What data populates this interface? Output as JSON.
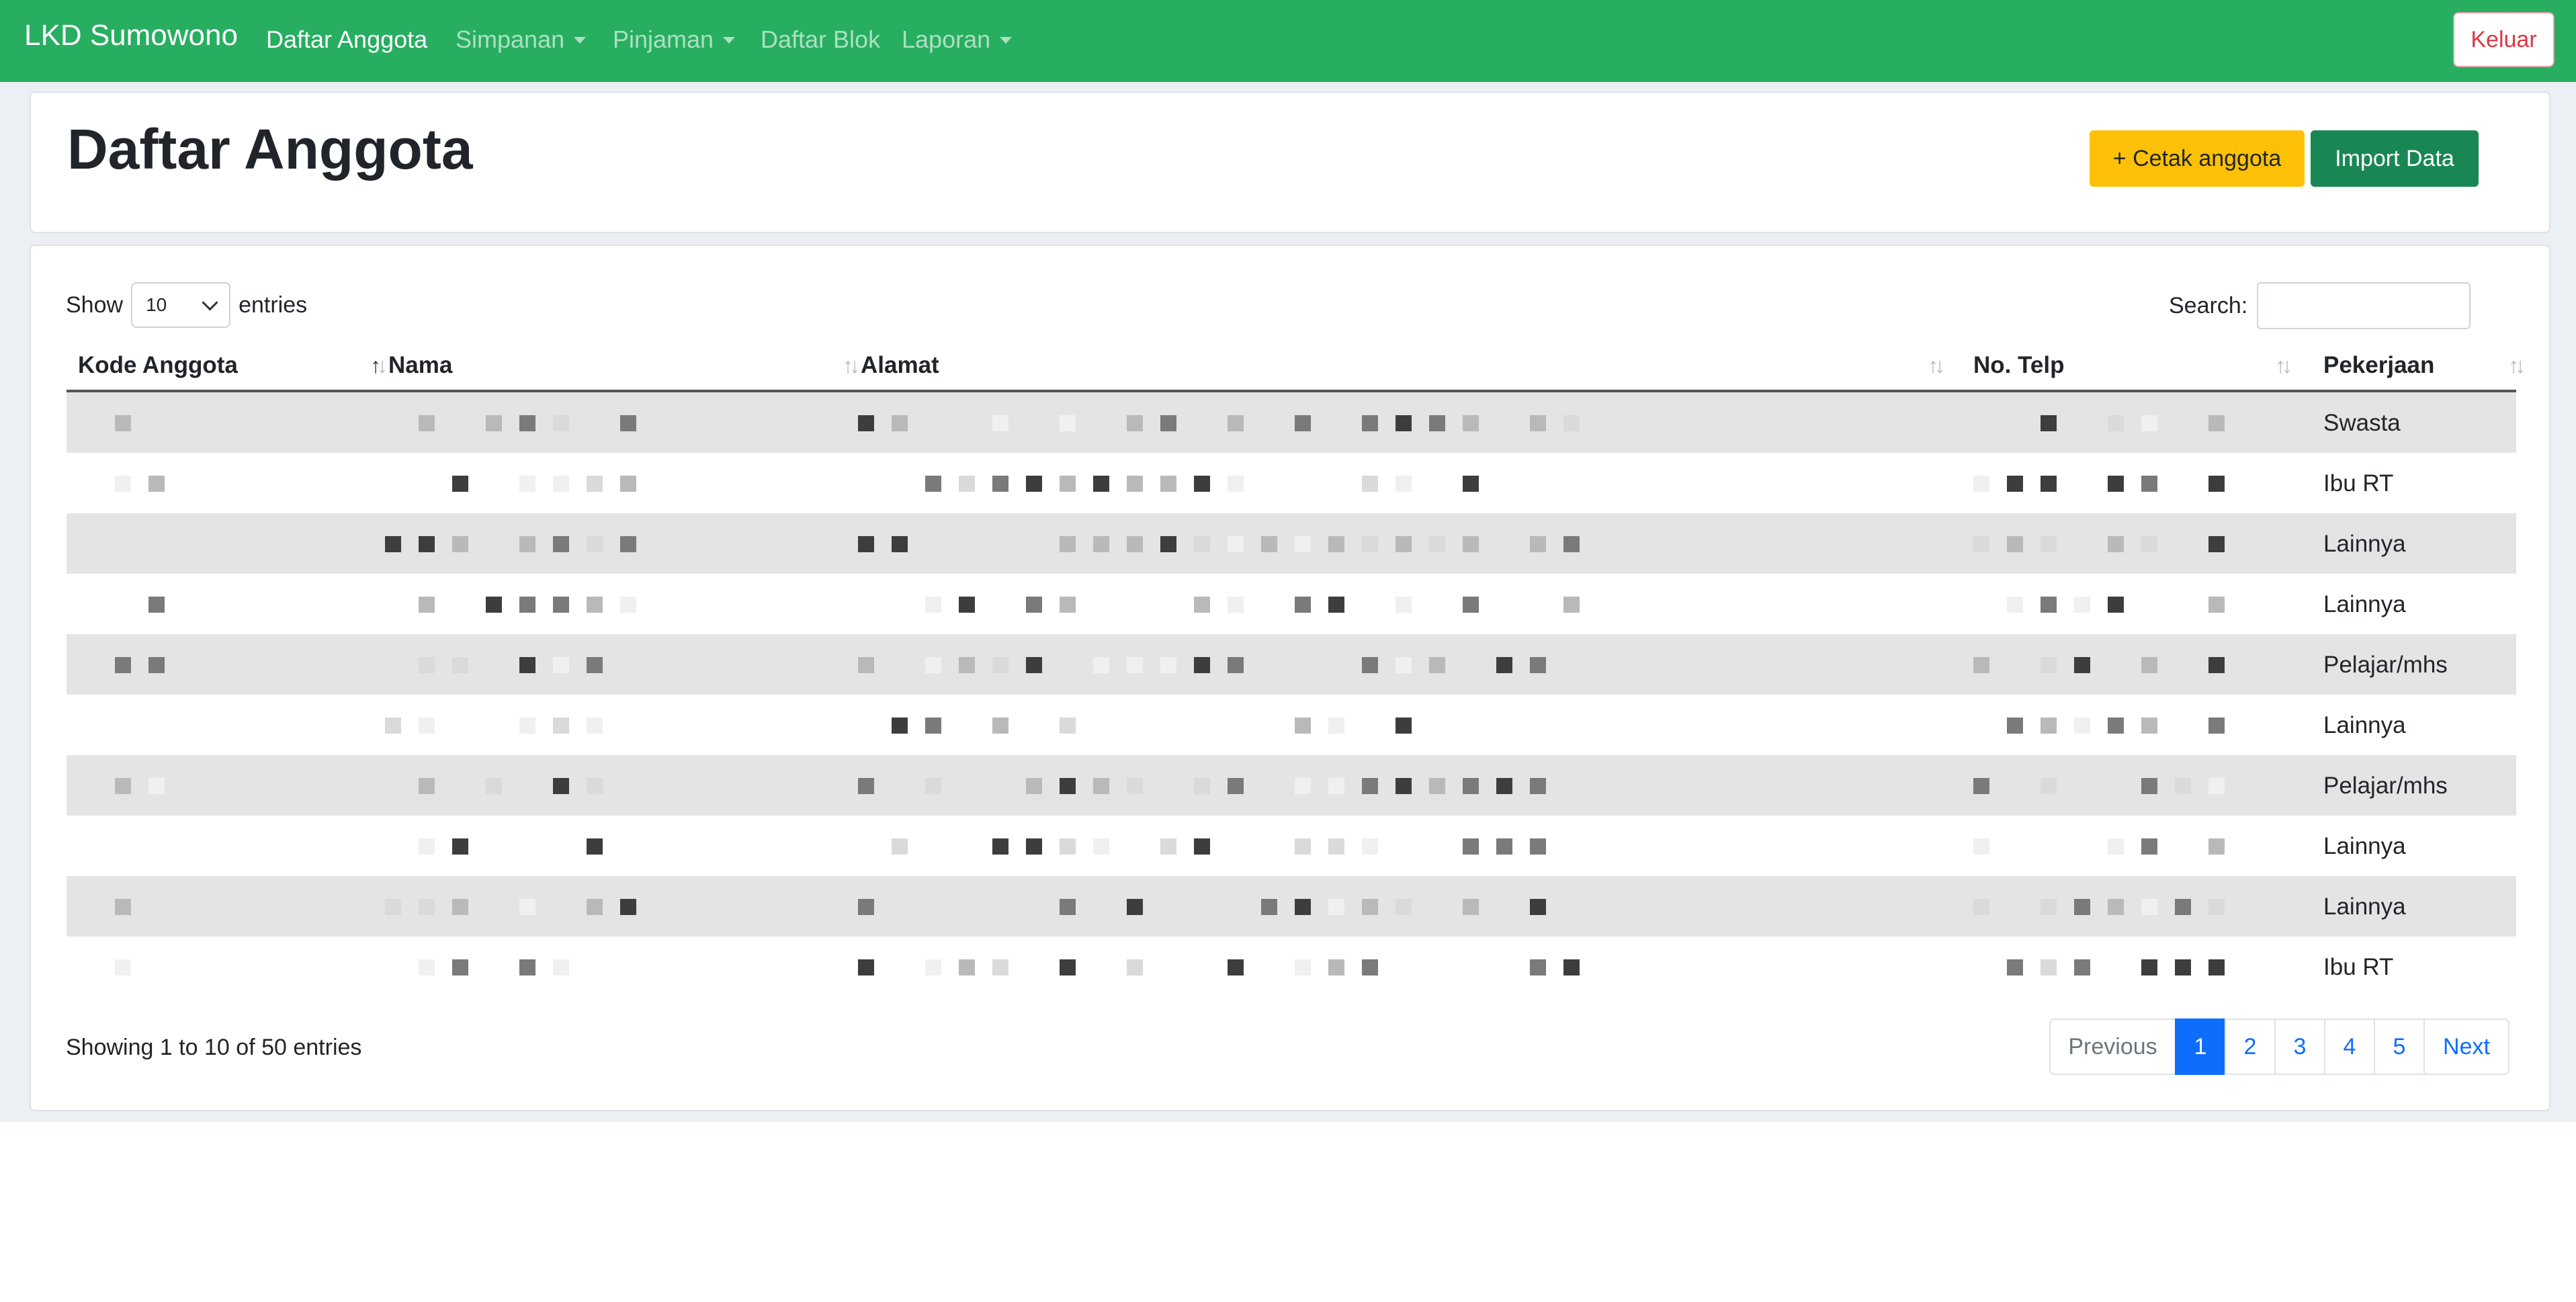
{
  "navbar": {
    "brand": "LKD Sumowono",
    "items": [
      {
        "label": "Daftar Anggota",
        "active": true,
        "dropdown": false
      },
      {
        "label": "Simpanan",
        "active": false,
        "dropdown": true
      },
      {
        "label": "Pinjaman",
        "active": false,
        "dropdown": true
      },
      {
        "label": "Daftar Blok",
        "active": false,
        "dropdown": false
      },
      {
        "label": "Laporan",
        "active": false,
        "dropdown": true
      }
    ],
    "logout_label": "Keluar"
  },
  "header": {
    "title": "Daftar Anggota",
    "print_button": "+ Cetak anggota",
    "import_button": "Import Data"
  },
  "table_controls": {
    "show_label": "Show",
    "entries_value": "10",
    "entries_label": "entries",
    "search_label": "Search:",
    "search_value": ""
  },
  "table": {
    "columns": [
      "Kode Anggota",
      "Nama",
      "Alamat",
      "No. Telp",
      "Pekerjaan"
    ],
    "sorted_column": "Kode Anggota",
    "rows": [
      {
        "pekerjaan": "Swasta"
      },
      {
        "pekerjaan": "Ibu RT"
      },
      {
        "pekerjaan": "Lainnya"
      },
      {
        "pekerjaan": "Lainnya"
      },
      {
        "pekerjaan": "Pelajar/mhs"
      },
      {
        "pekerjaan": "Lainnya"
      },
      {
        "pekerjaan": "Pelajar/mhs"
      },
      {
        "pekerjaan": "Lainnya"
      },
      {
        "pekerjaan": "Lainnya"
      },
      {
        "pekerjaan": "Ibu RT"
      }
    ],
    "redacted_columns": [
      "Kode Anggota",
      "Nama",
      "Alamat",
      "No. Telp"
    ]
  },
  "footer": {
    "info": "Showing 1 to 10 of 50 entries",
    "previous": "Previous",
    "pages": [
      "1",
      "2",
      "3",
      "4",
      "5"
    ],
    "current_page": "1",
    "next": "Next"
  },
  "colors": {
    "navbar": "#27ae60",
    "warning": "#ffc107",
    "success": "#198754",
    "primary": "#0d6efd",
    "danger": "#dc3545",
    "stripe": "#e4e4e4"
  }
}
